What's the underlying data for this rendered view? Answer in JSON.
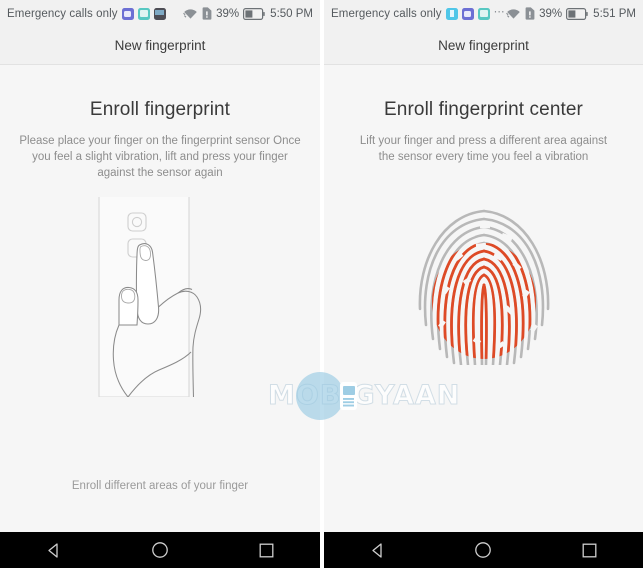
{
  "screens": [
    {
      "id": "left",
      "statusbar": {
        "carrier": "Emergency calls only",
        "icons": [
          "notification-icon-purple",
          "notification-icon-teal",
          "notification-icon-dark"
        ],
        "wifi_icon": "wifi-icon",
        "sim_icon": "sim-card-alert-icon",
        "battery_percent": "39%",
        "battery_icon": "battery-icon",
        "time": "5:50 PM"
      },
      "titlebar": {
        "title": "New fingerprint"
      },
      "heading": "Enroll fingerprint",
      "subtext": "Please place your finger on the fingerprint sensor Once you feel a slight vibration, lift and press your finger against the sensor again",
      "caption": "Enroll different areas of your finger",
      "art": "phone-back-hand-illustration",
      "navbar": {
        "back": "back-button",
        "home": "home-button",
        "recents": "recents-button"
      }
    },
    {
      "id": "right",
      "statusbar": {
        "carrier": "Emergency calls only",
        "icons": [
          "notification-icon-cyan",
          "notification-icon-purple",
          "notification-icon-teal"
        ],
        "overflow": "⋯",
        "wifi_icon": "wifi-icon",
        "sim_icon": "sim-card-alert-icon",
        "battery_percent": "39%",
        "battery_icon": "battery-icon",
        "time": "5:51 PM"
      },
      "titlebar": {
        "title": "New fingerprint"
      },
      "heading": "Enroll fingerprint center",
      "subtext": "Lift your finger and press a different area against the sensor every time you feel a vibration",
      "caption": "",
      "art": "fingerprint-ridges-illustration",
      "navbar": {
        "back": "back-button",
        "home": "home-button",
        "recents": "recents-button"
      }
    }
  ],
  "watermark": {
    "text": "MOBIGYAAN",
    "badge_icon": "phone-badge-icon"
  },
  "colors": {
    "fingerprint_active": "#de4a26",
    "fingerprint_inactive": "#b8b8b8",
    "page_background": "#f6f6f6",
    "bar_background": "#f1f1f1",
    "navbar_background": "#000000",
    "heading_text": "#3a3a3a",
    "body_text": "#8d8d8d"
  }
}
